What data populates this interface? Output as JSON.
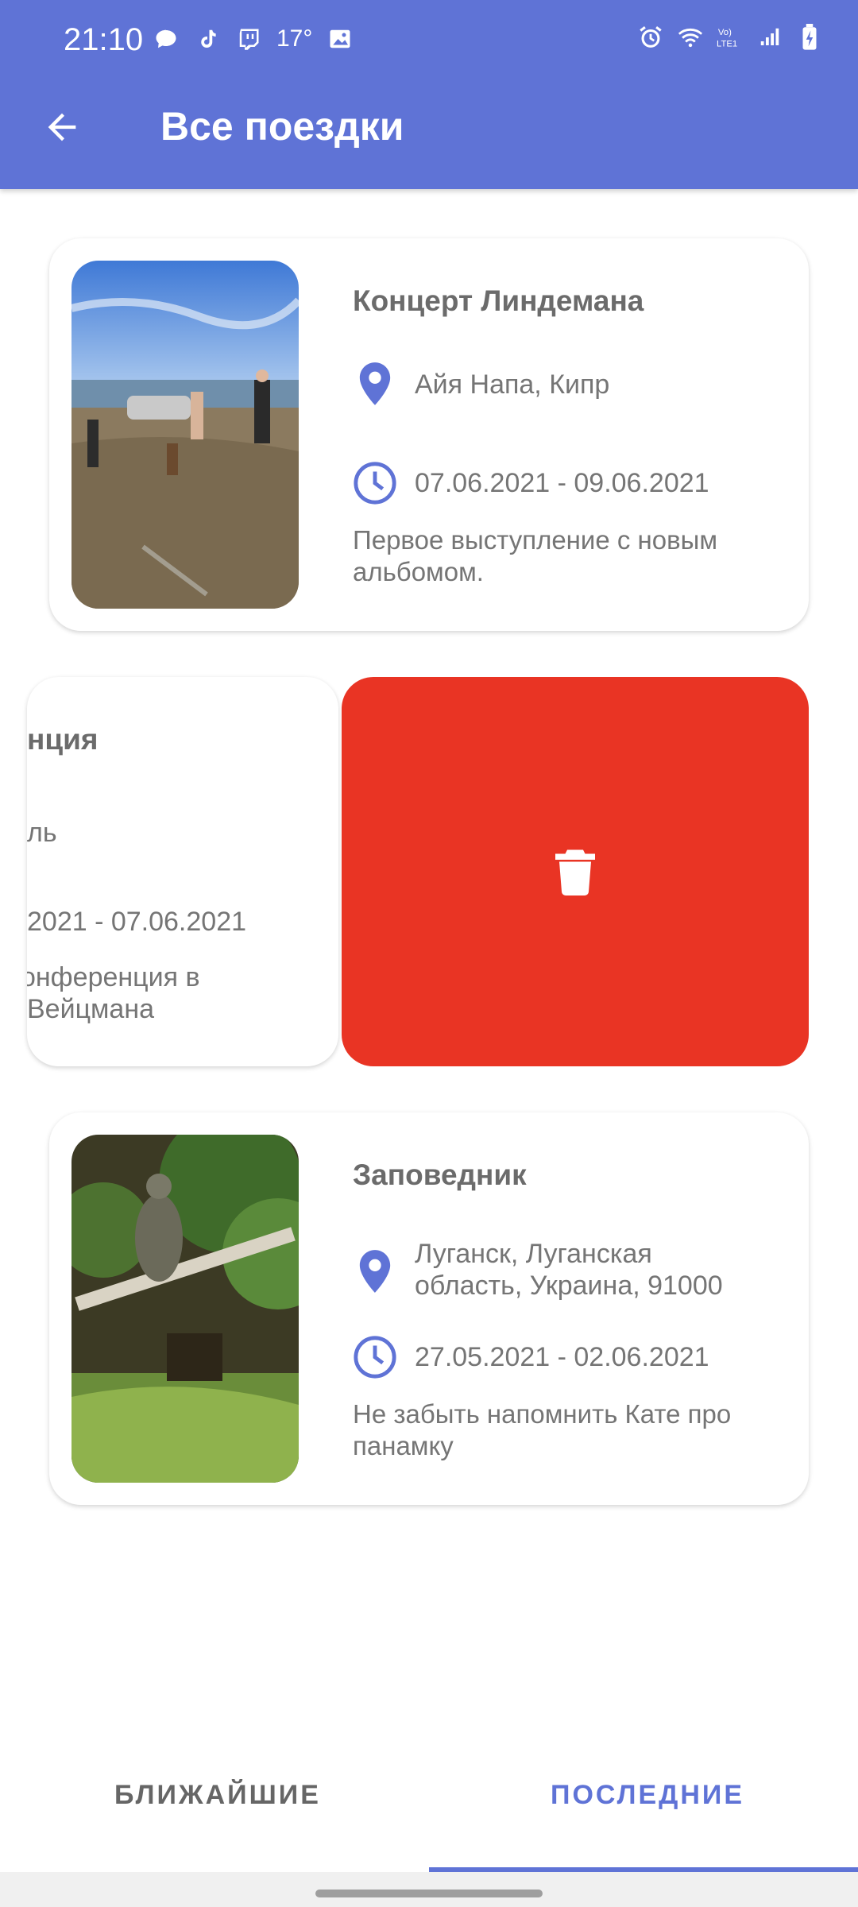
{
  "status_bar": {
    "time": "21:10",
    "temperature": "17°"
  },
  "app_bar": {
    "title": "Все поездки"
  },
  "trips": [
    {
      "title": "Концерт Линдемана",
      "location": "Айя Напа, Кипр",
      "dates": "07.06.2021 - 09.06.2021",
      "description": "Первое выступление с новым альбомом."
    },
    {
      "title": "нция",
      "location": "ль",
      "dates": "2021 - 07.06.2021",
      "description_line1": "онференция в",
      "description_line2": "Вейцмана"
    },
    {
      "title": "Заповедник",
      "location": "Луганск, Луганская область, Украина, 91000",
      "dates": "27.05.2021 - 02.06.2021",
      "description": "Не забыть напомнить Кате про панамку"
    }
  ],
  "tabs": {
    "near": "БЛИЖАЙШИЕ",
    "last": "ПОСЛЕДНИЕ",
    "active": "ПОСЛЕДНИЕ"
  },
  "colors": {
    "accent": "#5F73D6",
    "delete": "#E93424",
    "text": "#757575"
  }
}
